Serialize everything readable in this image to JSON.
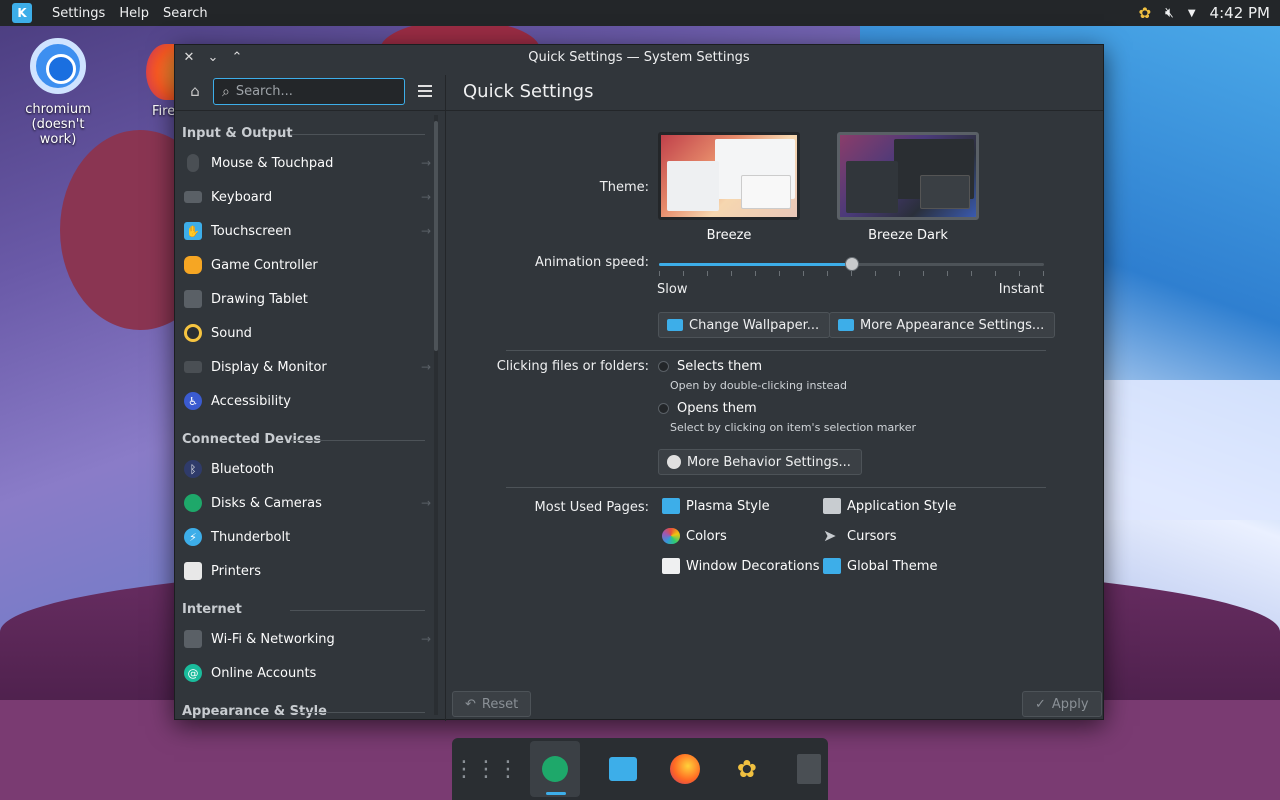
{
  "topbar": {
    "menu": [
      "Settings",
      "Help",
      "Search"
    ],
    "clock": "4:42 PM"
  },
  "desktop": {
    "icons": [
      {
        "label_line1": "chromium",
        "label_line2": "(doesn't work)"
      },
      {
        "label_line1": "Fire"
      }
    ]
  },
  "window": {
    "title": "Quick Settings — System Settings",
    "search_placeholder": "Search...",
    "page_title": "Quick Settings"
  },
  "sidebar": {
    "sections": [
      {
        "heading": "Input & Output",
        "items": [
          {
            "label": "Mouse & Touchpad",
            "arrow": true
          },
          {
            "label": "Keyboard",
            "arrow": true
          },
          {
            "label": "Touchscreen",
            "arrow": true
          },
          {
            "label": "Game Controller",
            "arrow": false
          },
          {
            "label": "Drawing Tablet",
            "arrow": false
          },
          {
            "label": "Sound",
            "arrow": false
          },
          {
            "label": "Display & Monitor",
            "arrow": true
          },
          {
            "label": "Accessibility",
            "arrow": false
          }
        ]
      },
      {
        "heading": "Connected Devices",
        "items": [
          {
            "label": "Bluetooth",
            "arrow": false
          },
          {
            "label": "Disks & Cameras",
            "arrow": true
          },
          {
            "label": "Thunderbolt",
            "arrow": false
          },
          {
            "label": "Printers",
            "arrow": false
          }
        ]
      },
      {
        "heading": "Internet",
        "items": [
          {
            "label": "Wi-Fi & Networking",
            "arrow": true
          },
          {
            "label": "Online Accounts",
            "arrow": false
          }
        ]
      },
      {
        "heading": "Appearance & Style",
        "items": []
      }
    ]
  },
  "main": {
    "theme_label": "Theme:",
    "themes": [
      {
        "name": "Breeze"
      },
      {
        "name": "Breeze Dark"
      }
    ],
    "animation_label": "Animation speed:",
    "animation_value": 0.5,
    "slider_min_label": "Slow",
    "slider_max_label": "Instant",
    "change_wallpaper": "Change Wallpaper...",
    "more_appearance": "More Appearance Settings...",
    "clicking_label": "Clicking files or folders:",
    "radio_selects": "Selects them",
    "radio_selects_hint": "Open by double-clicking instead",
    "radio_opens": "Opens them",
    "radio_opens_hint": "Select by clicking on item's selection marker",
    "more_behavior": "More Behavior Settings...",
    "most_used_label": "Most Used Pages:",
    "most_used": [
      "Plasma Style",
      "Application Style",
      "Colors",
      "Cursors",
      "Window Decorations",
      "Global Theme"
    ],
    "reset": "Reset",
    "apply": "Apply"
  },
  "colors": {
    "accent": "#3daee9",
    "window_bg": "#31363b",
    "panel_bg": "#232629"
  }
}
